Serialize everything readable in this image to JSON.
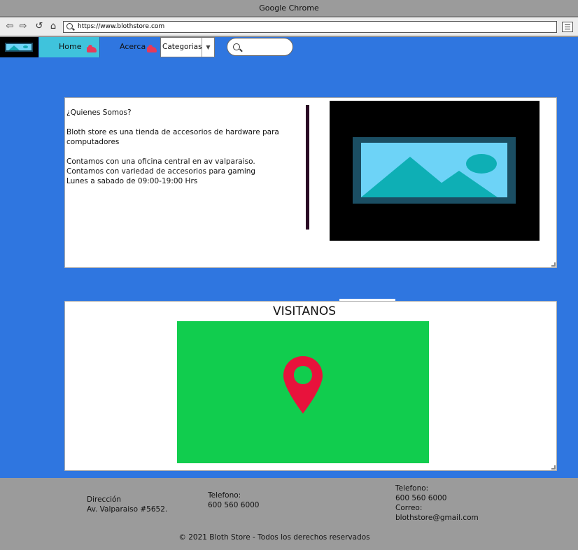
{
  "window": {
    "title": "Google Chrome"
  },
  "browser": {
    "url": "https://www.blothstore.com"
  },
  "nav": {
    "home_label": "Home",
    "about_label": "Acerca",
    "categories_label": "Categorias",
    "search_placeholder": ""
  },
  "about": {
    "text": "¿Quienes Somos?\n\nBloth store es una tienda de accesorios de hardware para computadores\n\nContamos con una oficina central en av valparaiso.\nContamos con variedad de accesorios para gaming\nLunes a sabado de 09:00-19:00 Hrs"
  },
  "visit": {
    "title": "VISITANOS"
  },
  "footer": {
    "address": "Dirección\nAv. Valparaiso #5652.",
    "phone": "Telefono:\n600 560 6000",
    "contact": " Telefono:\n600 560 6000\n Correo:\nblothstore@gmail.com",
    "copyright": "© 2021 Bloth Store - Todos los derechos reservados"
  },
  "icons": [
    "search-icon",
    "menu-icon",
    "back-icon",
    "forward-icon",
    "reload-icon",
    "home-icon",
    "logo-image-icon",
    "hand-pointer-icon",
    "dropdown-arrow-icon",
    "image-placeholder-icon",
    "location-pin-icon"
  ],
  "colors": {
    "page_bg": "#2f76e0",
    "home_tab": "#3fc3dc",
    "map_bg": "#11cd4e",
    "pin": "#e8123c",
    "footer_bg": "#9b9b9b"
  }
}
